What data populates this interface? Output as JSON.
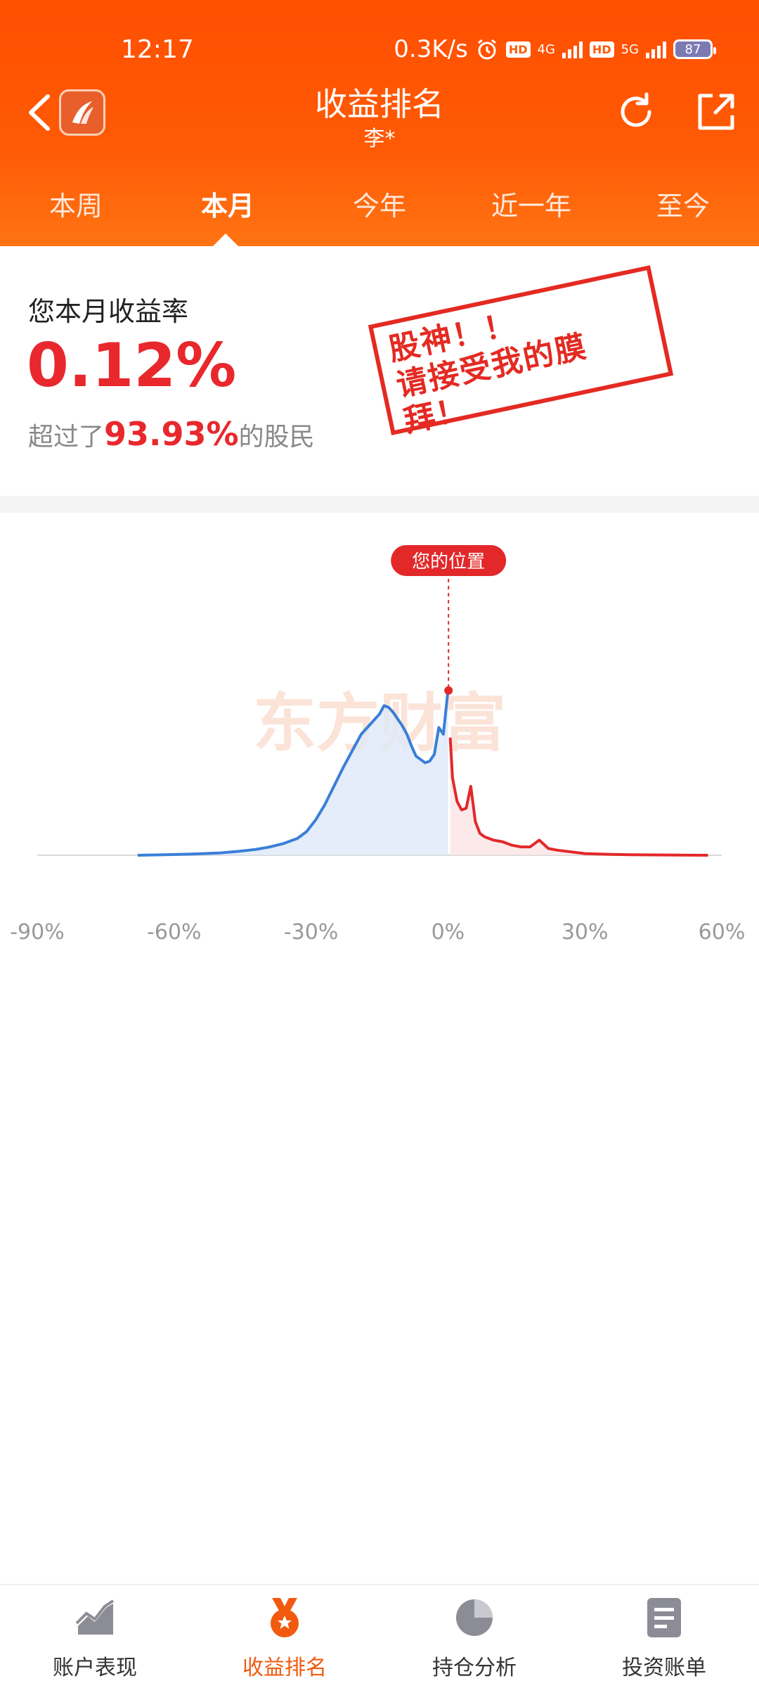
{
  "status_bar": {
    "time": "12:17",
    "speed": "0.3K/s",
    "net1": "4G",
    "net2": "5G",
    "battery": "87",
    "hd": "HD",
    "alarm_icon": "alarm-icon"
  },
  "header": {
    "title": "收益排名",
    "subtitle": "李*",
    "back_icon": "back-arrow-icon",
    "logo": "eastmoney-logo",
    "refresh_icon": "refresh-icon",
    "share_icon": "share-icon"
  },
  "tabs": [
    {
      "label": "本周"
    },
    {
      "label": "本月"
    },
    {
      "label": "今年"
    },
    {
      "label": "近一年"
    },
    {
      "label": "至今"
    }
  ],
  "active_tab": "本月",
  "summary": {
    "label": "您本月收益率",
    "rate": "0.12%",
    "beat_prefix": "超过了",
    "beat_pct": "93.93%",
    "beat_suffix": "的股民",
    "stamp_line1": "股神！！",
    "stamp_line2": "请接受我的膜拜！"
  },
  "chart_data": {
    "type": "area",
    "watermark": "东方财富",
    "marker_label": "您的位置",
    "marker_x": 0.12,
    "x_ticks": [
      "-90%",
      "-60%",
      "-30%",
      "0%",
      "30%",
      "60%"
    ],
    "xlim": [
      -90,
      60
    ],
    "ylim": [
      0,
      100
    ],
    "negative_color": "#3a7fd8",
    "positive_color": "#e3282a",
    "series": {
      "x": [
        -68,
        -62,
        -56,
        -50,
        -46,
        -42,
        -39,
        -36,
        -33,
        -31,
        -29,
        -27,
        -25,
        -23,
        -21,
        -19,
        -17,
        -15,
        -14,
        -13,
        -12,
        -11,
        -10,
        -9,
        -8,
        -7,
        -6,
        -5,
        -4,
        -3,
        -2,
        -1,
        0,
        0.5,
        1,
        2,
        3,
        4,
        5,
        6,
        7,
        8,
        10,
        12,
        14,
        16,
        18,
        20,
        22,
        24,
        27,
        30,
        35,
        40,
        45,
        50,
        57
      ],
      "y": [
        0,
        0.3,
        0.7,
        1.4,
        2.3,
        3.5,
        5,
        7,
        10,
        14,
        21,
        30,
        41,
        52,
        62,
        72,
        78,
        84,
        89,
        88,
        85,
        81,
        77,
        72,
        65,
        59,
        57,
        55,
        56,
        60,
        76,
        72,
        98,
        70,
        46,
        32,
        27,
        28,
        41,
        20,
        13,
        11,
        9,
        8,
        6,
        5,
        5,
        9,
        4,
        3,
        2,
        1,
        0.6,
        0.3,
        0.2,
        0.1,
        0
      ]
    }
  },
  "bottom_nav": [
    {
      "label": "账户表现",
      "icon": "trend-chart-icon"
    },
    {
      "label": "收益排名",
      "icon": "medal-icon"
    },
    {
      "label": "持仓分析",
      "icon": "pie-chart-icon"
    },
    {
      "label": "投资账单",
      "icon": "bill-icon"
    }
  ],
  "colors": {
    "header_orange": "#ff5a06",
    "accent_red": "#e8282d",
    "nav_active": "#f15a0f"
  }
}
